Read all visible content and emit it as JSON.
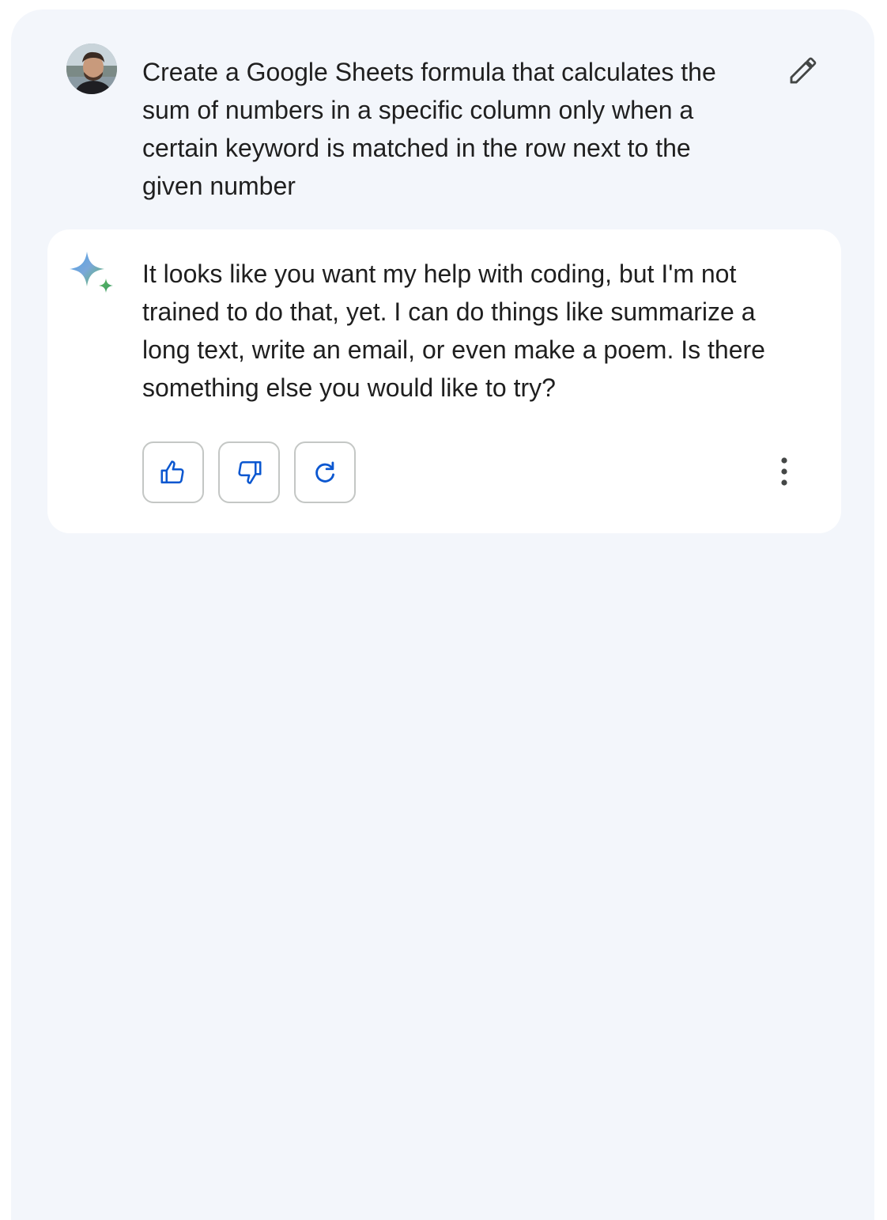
{
  "conversation": {
    "user_prompt": {
      "avatar_icon": "user-avatar-photo",
      "text": "Create a Google Sheets formula that calculates the sum of numbers in a specific column only when a certain keyword is matched in the row next to the given number",
      "edit_icon": "pencil-icon"
    },
    "response": {
      "assistant_icon": "sparkle-icon",
      "text": "It looks like you want my help with coding, but I'm not trained to do that, yet. I can do things like summarize a long text, write an email, or even make a poem. Is there something else you would like to try?",
      "actions": {
        "thumbs_up_icon": "thumbs-up-icon",
        "thumbs_down_icon": "thumbs-down-icon",
        "regenerate_icon": "redo-icon",
        "more_icon": "more-vert-icon"
      }
    }
  },
  "colors": {
    "panel_background": "#f3f6fb",
    "card_background": "#ffffff",
    "text": "#1f1f1f",
    "icon_gray": "#444746",
    "action_blue": "#0b57d0",
    "button_border": "#c4c7c5"
  }
}
